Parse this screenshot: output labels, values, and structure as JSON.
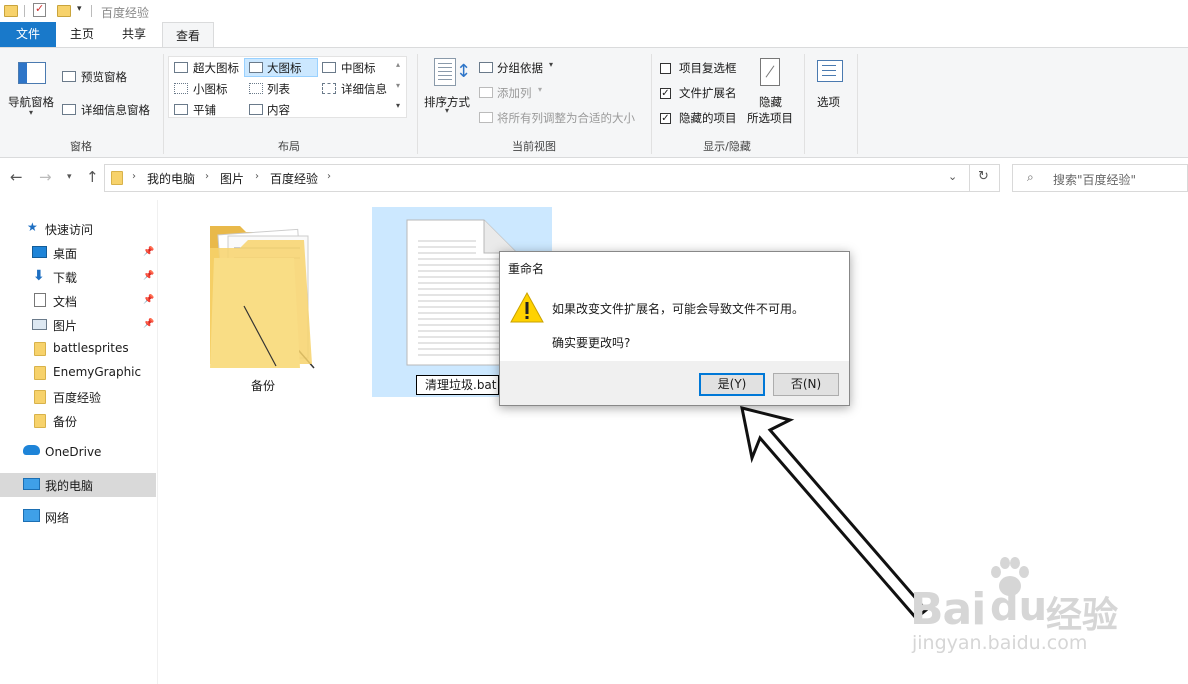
{
  "window": {
    "title": "百度经验"
  },
  "tabs": [
    {
      "label": "文件"
    },
    {
      "label": "主页"
    },
    {
      "label": "共享"
    },
    {
      "label": "查看"
    }
  ],
  "ribbon": {
    "panes": {
      "nav_pane": "导航窗格",
      "preview_pane": "预览窗格",
      "details_pane": "详细信息窗格",
      "group_label": "窗格"
    },
    "layout": {
      "items": [
        "超大图标",
        "大图标",
        "中图标",
        "小图标",
        "列表",
        "详细信息",
        "平铺",
        "内容"
      ],
      "selected": "大图标",
      "group_label": "布局"
    },
    "current_view": {
      "sort_by": "排序方式",
      "group_by": "分组依据",
      "add_columns": "添加列",
      "size_all_columns": "将所有列调整为合适的大小",
      "group_label": "当前视图"
    },
    "show_hide": {
      "item_checkboxes": "项目复选框",
      "file_name_extensions": "文件扩展名",
      "hidden_items": "隐藏的项目",
      "hide_selected_line1": "隐藏",
      "hide_selected_line2": "所选项目",
      "group_label": "显示/隐藏",
      "item_checkboxes_checked": false,
      "file_name_extensions_checked": true,
      "hidden_items_checked": true
    },
    "options": "选项"
  },
  "address": {
    "breadcrumb": [
      "我的电脑",
      "图片",
      "百度经验"
    ],
    "search_placeholder": "搜索\"百度经验\""
  },
  "nav": {
    "quick_access": "快速访问",
    "quick_items": [
      {
        "label": "桌面",
        "pinned": true
      },
      {
        "label": "下载",
        "pinned": true
      },
      {
        "label": "文档",
        "pinned": true
      },
      {
        "label": "图片",
        "pinned": true
      }
    ],
    "folders": [
      "battlesprites",
      "EnemyGraphic",
      "百度经验",
      "备份"
    ],
    "onedrive": "OneDrive",
    "this_pc": "我的电脑",
    "network": "网络"
  },
  "content": {
    "items": [
      {
        "name": "备份",
        "kind": "folder"
      },
      {
        "name": "清理垃圾.bat",
        "kind": "file",
        "selected": true,
        "renaming": true
      }
    ]
  },
  "dialog": {
    "title": "重命名",
    "message": "如果改变文件扩展名，可能会导致文件不可用。",
    "question": "确实要更改吗?",
    "yes_label": "是(Y)",
    "no_label": "否(N)"
  },
  "watermark": {
    "line1": "Bai",
    "line1b": "du",
    "line1c": "经验",
    "line2": "jingyan.baidu.com"
  },
  "colors": {
    "accent": "#1979ca",
    "selection": "#cce8ff",
    "folder": "#f7d26b",
    "warning": "#ffd200"
  }
}
